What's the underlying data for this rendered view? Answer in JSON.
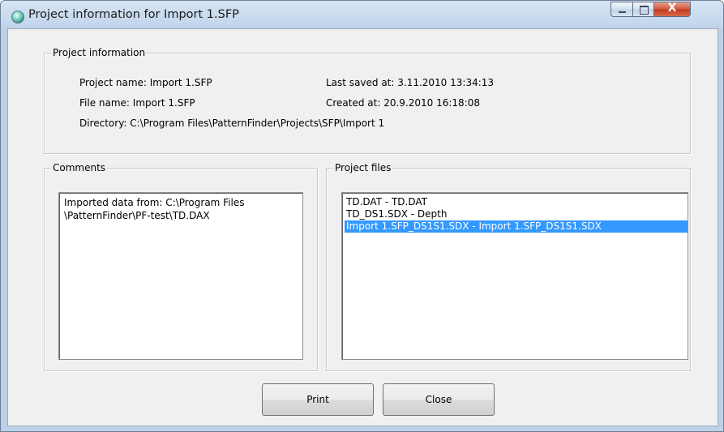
{
  "window": {
    "title": "Project information for Import 1.SFP",
    "controls": {
      "minimize": "minimize",
      "maximize": "maximize",
      "close": "X"
    }
  },
  "project_info": {
    "group_title": "Project information",
    "project_name": "Project name: Import 1.SFP",
    "file_name": "File name: Import 1.SFP",
    "directory": "Directory: C:\\Program Files\\PatternFinder\\Projects\\SFP\\Import 1",
    "last_saved": "Last saved at: 3.11.2010 13:34:13",
    "created": "Created at: 20.9.2010 16:18:08"
  },
  "comments": {
    "group_title": "Comments",
    "line1": "Imported data from: C:\\Program Files",
    "line2": "\\PatternFinder\\PF-test\\TD.DAX"
  },
  "project_files": {
    "group_title": "Project files",
    "items": [
      {
        "label": "TD.DAT - TD.DAT",
        "selected": false
      },
      {
        "label": "TD_DS1.SDX - Depth",
        "selected": false
      },
      {
        "label": "Import 1.SFP_DS1S1.SDX - Import 1.SFP_DS1S1.SDX",
        "selected": true
      }
    ]
  },
  "buttons": {
    "print": "Print",
    "close": "Close"
  }
}
